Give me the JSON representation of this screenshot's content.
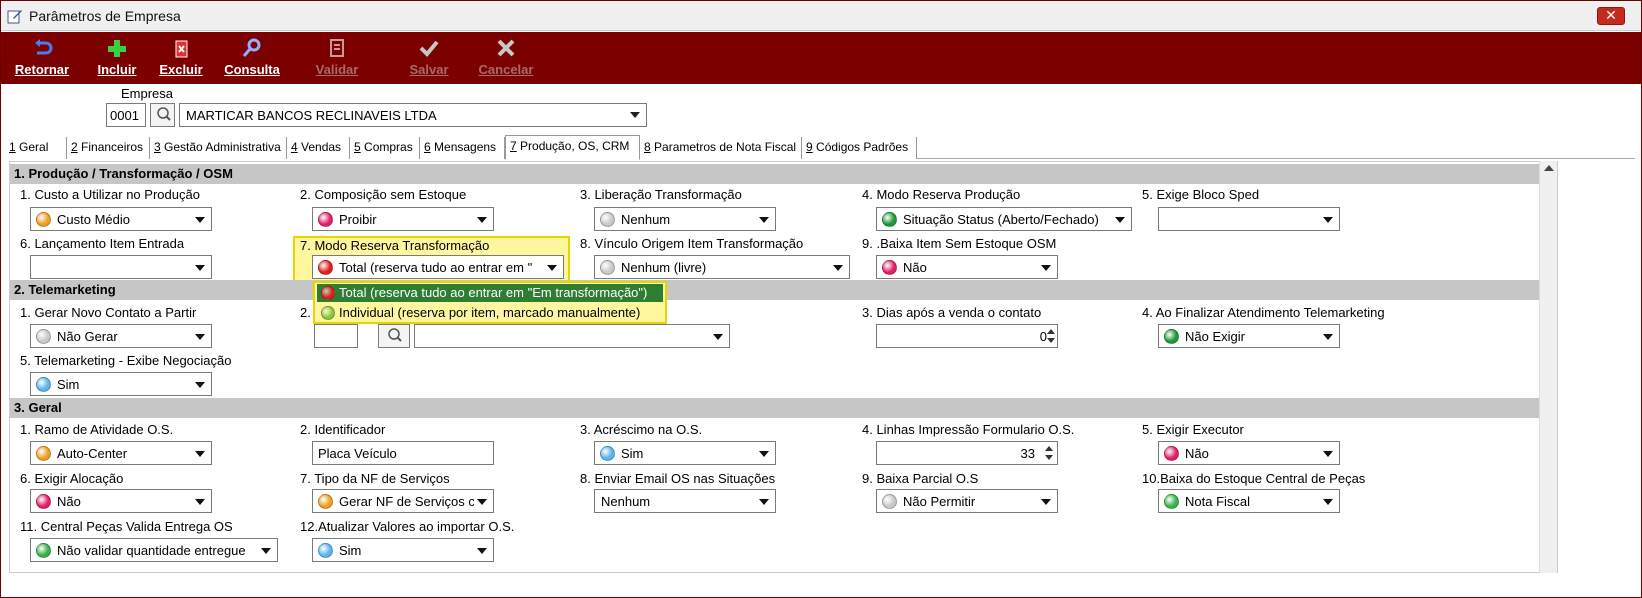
{
  "window": {
    "title": "Parâmetros de Empresa",
    "close_label": "✕"
  },
  "toolbar": {
    "buttons": [
      {
        "label": "Retornar",
        "icon": "return-arrow-icon",
        "enabled": true
      },
      {
        "label": "Incluir",
        "icon": "plus-icon",
        "enabled": true
      },
      {
        "label": "Excluir",
        "icon": "delete-icon",
        "enabled": true
      },
      {
        "label": "Consulta",
        "icon": "search-icon",
        "enabled": true
      },
      {
        "label": "Validar",
        "icon": "validate-icon",
        "enabled": false
      },
      {
        "label": "Salvar",
        "icon": "check-icon",
        "enabled": false
      },
      {
        "label": "Cancelar",
        "icon": "x-icon",
        "enabled": false
      }
    ]
  },
  "empresa": {
    "label": "Empresa",
    "code": "0001",
    "name": "MARTICAR BANCOS RECLINAVEIS LTDA"
  },
  "tabs": [
    {
      "num": "1",
      "label": " Geral"
    },
    {
      "num": "2",
      "label": " Financeiros"
    },
    {
      "num": "3",
      "label": " Gestão Administrativa"
    },
    {
      "num": "4",
      "label": " Vendas"
    },
    {
      "num": "5",
      "label": " Compras"
    },
    {
      "num": "6",
      "label": " Mensagens"
    },
    {
      "num": "7",
      "label": " Produção, OS, CRM",
      "active": true
    },
    {
      "num": "8",
      "label": " Parametros de Nota Fiscal"
    },
    {
      "num": "9",
      "label": " Códigos Padrões"
    }
  ],
  "sections": {
    "s1": {
      "title": "1. Produção / Transformação / OSM",
      "f1": {
        "label": "1. Custo a Utilizar no Produção",
        "value": "Custo Médio",
        "dot": "#f0a020"
      },
      "f2": {
        "label": "2. Composição sem Estoque",
        "value": "Proibir",
        "dot": "#e0206a"
      },
      "f3": {
        "label": "3. Liberação Transformação",
        "value": "Nenhum",
        "dot": "#c8c8c8"
      },
      "f4": {
        "label": "4. Modo Reserva Produção",
        "value": "Situação Status (Aberto/Fechado)",
        "dot": "#1f9a3a"
      },
      "f5": {
        "label": "5. Exige Bloco Sped",
        "value": ""
      },
      "f6": {
        "label": "6. Lançamento Item Entrada",
        "value": ""
      },
      "f7": {
        "label": "7. Modo Reserva Transformação",
        "value": "Total (reserva tudo ao entrar em \"",
        "dot": "#e02020"
      },
      "f8": {
        "label": "8. Vínculo Origem Item Transformação",
        "value": "Nenhum (livre)",
        "dot": "#c8c8c8"
      },
      "f9": {
        "label": "9. .Baixa Item Sem Estoque OSM",
        "value": "Não",
        "dot": "#e0206a"
      }
    },
    "s2": {
      "title": "2. Telemarketing",
      "f1": {
        "label": "1. Gerar Novo Contato a Partir",
        "value": "Não Gerar",
        "dot": "#c8c8c8"
      },
      "f2": {
        "label": "2.",
        "code": "",
        "value": ""
      },
      "f3": {
        "label": "3. Dias após a venda o contato",
        "value": "0"
      },
      "f4": {
        "label": "4. Ao Finalizar Atendimento Telemarketing",
        "value": "Não Exigir",
        "dot": "#1f9a3a"
      },
      "f5": {
        "label": "5. Telemarketing - Exibe Negociação",
        "value": "Sim",
        "dot": "#5ab4f0"
      }
    },
    "s3": {
      "title": "3. Geral",
      "f1": {
        "label": "1. Ramo de Atividade O.S.",
        "value": "Auto-Center",
        "dot": "#f0a020"
      },
      "f2": {
        "label": "2. Identificador",
        "value": "Placa Veículo"
      },
      "f3": {
        "label": "3. Acréscimo na O.S.",
        "value": "Sim",
        "dot": "#5ab4f0"
      },
      "f4": {
        "label": "4. Linhas Impressão Formulario O.S.",
        "value": "33"
      },
      "f5": {
        "label": "5. Exigir Executor",
        "value": "Não",
        "dot": "#e0206a"
      },
      "f6": {
        "label": "6. Exigir Alocação",
        "value": "Não",
        "dot": "#e0206a"
      },
      "f7": {
        "label": "7. Tipo da NF de Serviços",
        "value": "Gerar NF de Serviços c",
        "dot": "#f0a020"
      },
      "f8": {
        "label": "8. Enviar Email OS nas Situações",
        "value": "Nenhum"
      },
      "f9": {
        "label": "9. Baixa Parcial O.S",
        "value": "Não Permitir",
        "dot": "#c8c8c8"
      },
      "f10": {
        "label": "10.Baixa do Estoque Central de Peças",
        "value": "Nota Fiscal",
        "dot": "#3cb04a"
      },
      "f11": {
        "label": "11. Central Peças Valida Entrega OS",
        "value": "Não validar quantidade entregue",
        "dot": "#3cb04a"
      },
      "f12": {
        "label": "12.Atualizar Valores ao importar O.S.",
        "value": "Sim",
        "dot": "#5ab4f0"
      }
    }
  },
  "dropdown": {
    "options": [
      {
        "label": "Total (reserva tudo ao entrar em \"Em transformação\")",
        "dot": "#e02020",
        "selected": true
      },
      {
        "label": "Individual (reserva por item, marcado manualmente)",
        "dot": "#8ac83a",
        "selected": false
      }
    ]
  }
}
